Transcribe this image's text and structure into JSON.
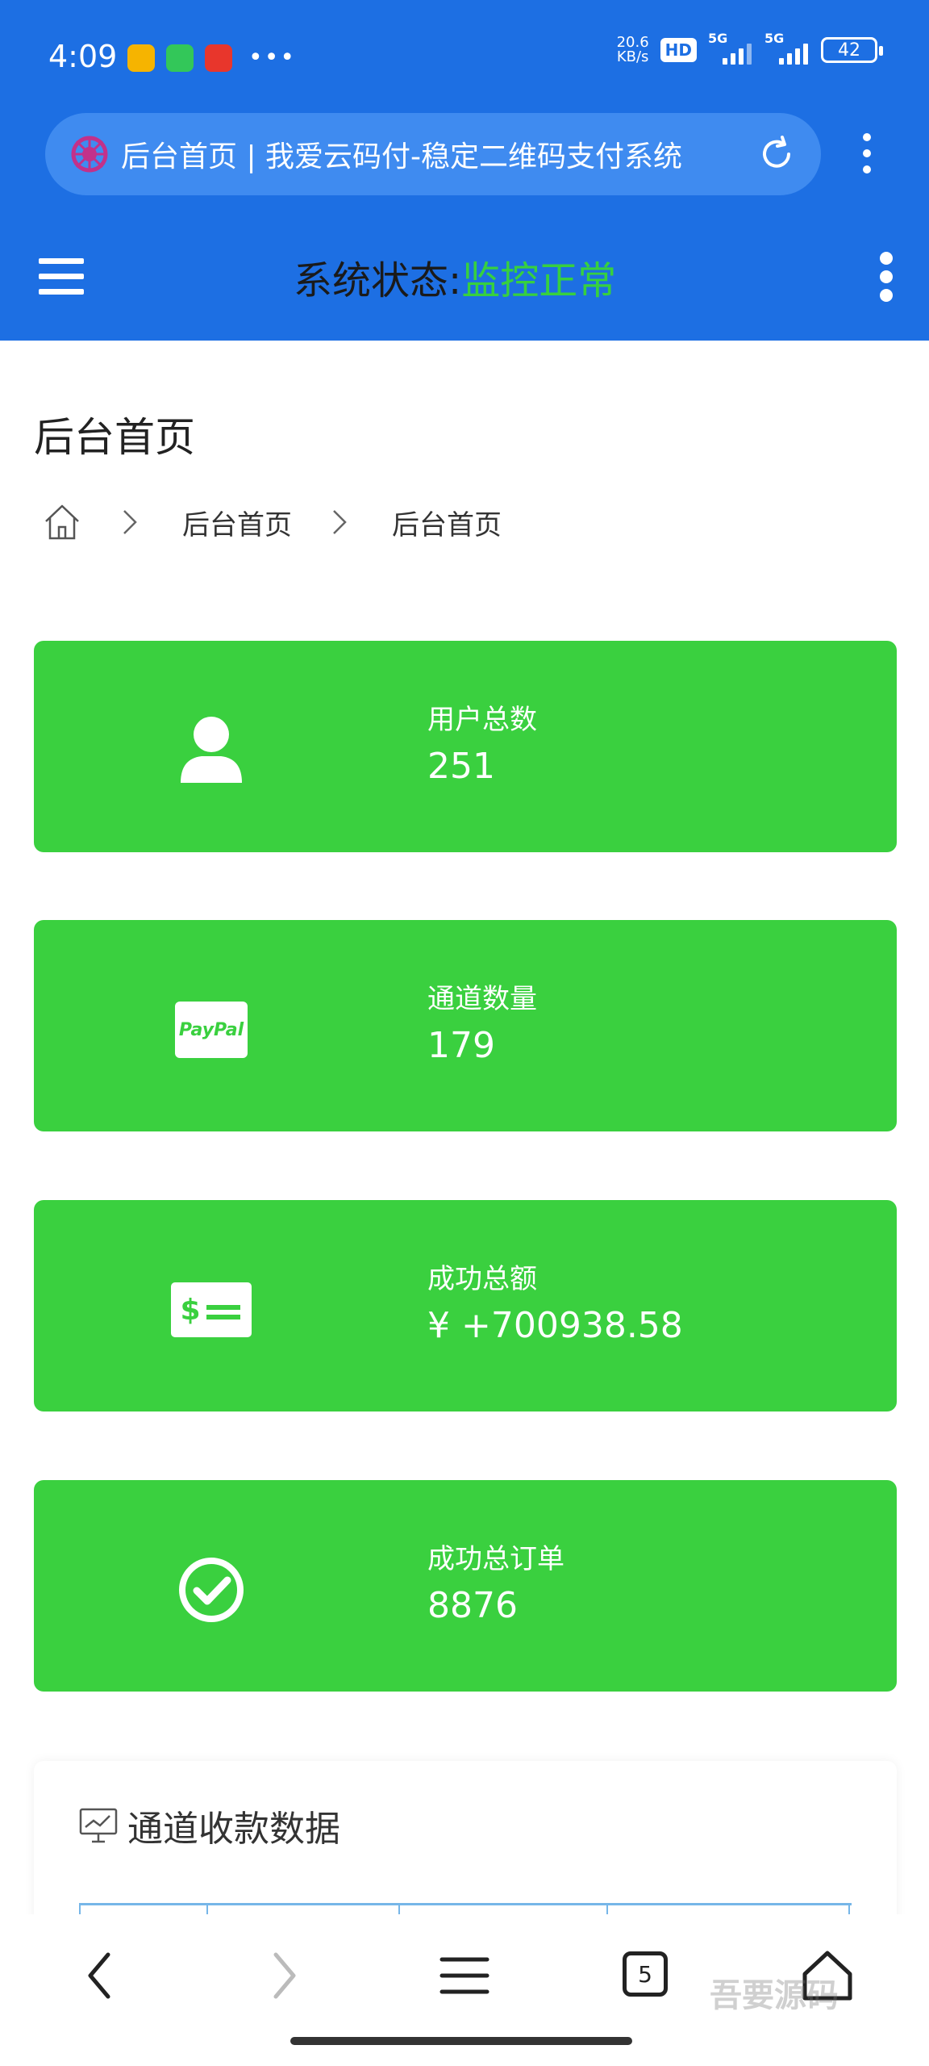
{
  "status_bar": {
    "time": "4:09",
    "net_speed_value": "20.6",
    "net_speed_unit": "KB/s",
    "hd_label": "HD",
    "sim1_label": "5G",
    "sim2_label": "5G",
    "battery": "42"
  },
  "browser": {
    "url_title": "后台首页 | 我爱云码付-稳定二维码支付系统",
    "tab_count": "5"
  },
  "header": {
    "status_label": "系统状态:",
    "status_value": "监控正常"
  },
  "page": {
    "title": "后台首页",
    "breadcrumb": [
      "后台首页",
      "后台首页"
    ]
  },
  "cards": [
    {
      "label": "用户总数",
      "value": "251",
      "icon": "user-icon"
    },
    {
      "label": "通道数量",
      "value": "179",
      "icon": "paypal-icon"
    },
    {
      "label": "成功总额",
      "value": "¥ +700938.58",
      "icon": "money-icon"
    },
    {
      "label": "成功总订单",
      "value": "8876",
      "icon": "check-circle-icon"
    }
  ],
  "panel": {
    "title": "通道收款数据"
  },
  "paypal_logo_text": "PayPal",
  "watermark": "吾要源码",
  "colors": {
    "primary_blue": "#1d6fe3",
    "success_green": "#3ad03f",
    "status_ok": "#37d03f"
  }
}
